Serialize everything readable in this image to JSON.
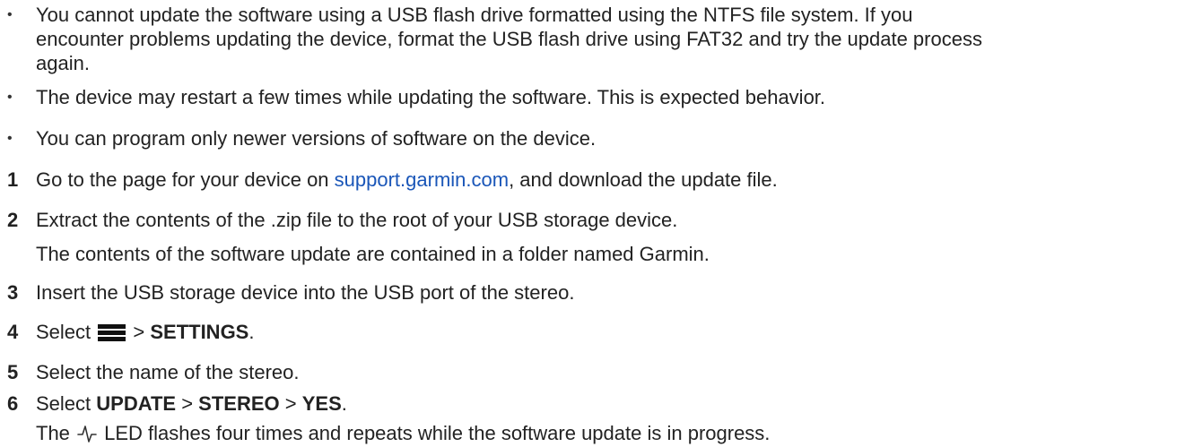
{
  "bullets": [
    {
      "marker": "•",
      "lines": [
        "You cannot update the software using a USB flash drive formatted using the NTFS file system. If you",
        "encounter problems updating the device, format the USB flash drive using FAT32 and try the update process",
        "again."
      ]
    },
    {
      "marker": "•",
      "text": "The device may restart a few times while updating the software. This is expected behavior."
    },
    {
      "marker": "•",
      "text": "You can program only newer versions of software on the device."
    }
  ],
  "steps": [
    {
      "num": "1",
      "pre": "Go to the page for your device on ",
      "link": "support.garmin.com",
      "post": ", and download the update file."
    },
    {
      "num": "2",
      "text": "Extract the contents of the .zip file to the root of your USB storage device.",
      "note": "The contents of the software update are contained in a folder named Garmin."
    },
    {
      "num": "3",
      "text": "Insert the USB storage device into the USB port of the stereo."
    },
    {
      "num": "4",
      "pre": "Select ",
      "icon": "menu-icon",
      "sep": " > ",
      "bold": "SETTINGS",
      "post": "."
    },
    {
      "num": "5",
      "text": "Select the name of the stereo."
    },
    {
      "num": "6",
      "pre": "Select ",
      "b1": "UPDATE",
      "s1": " > ",
      "b2": "STEREO",
      "s2": " > ",
      "b3": "YES",
      "post": ".",
      "note_pre": "The ",
      "note_icon": "led-pulse-icon",
      "note_post": " LED flashes four times and repeats while the software update is in progress."
    }
  ],
  "colors": {
    "text": "#222222",
    "link": "#1a56b8"
  }
}
